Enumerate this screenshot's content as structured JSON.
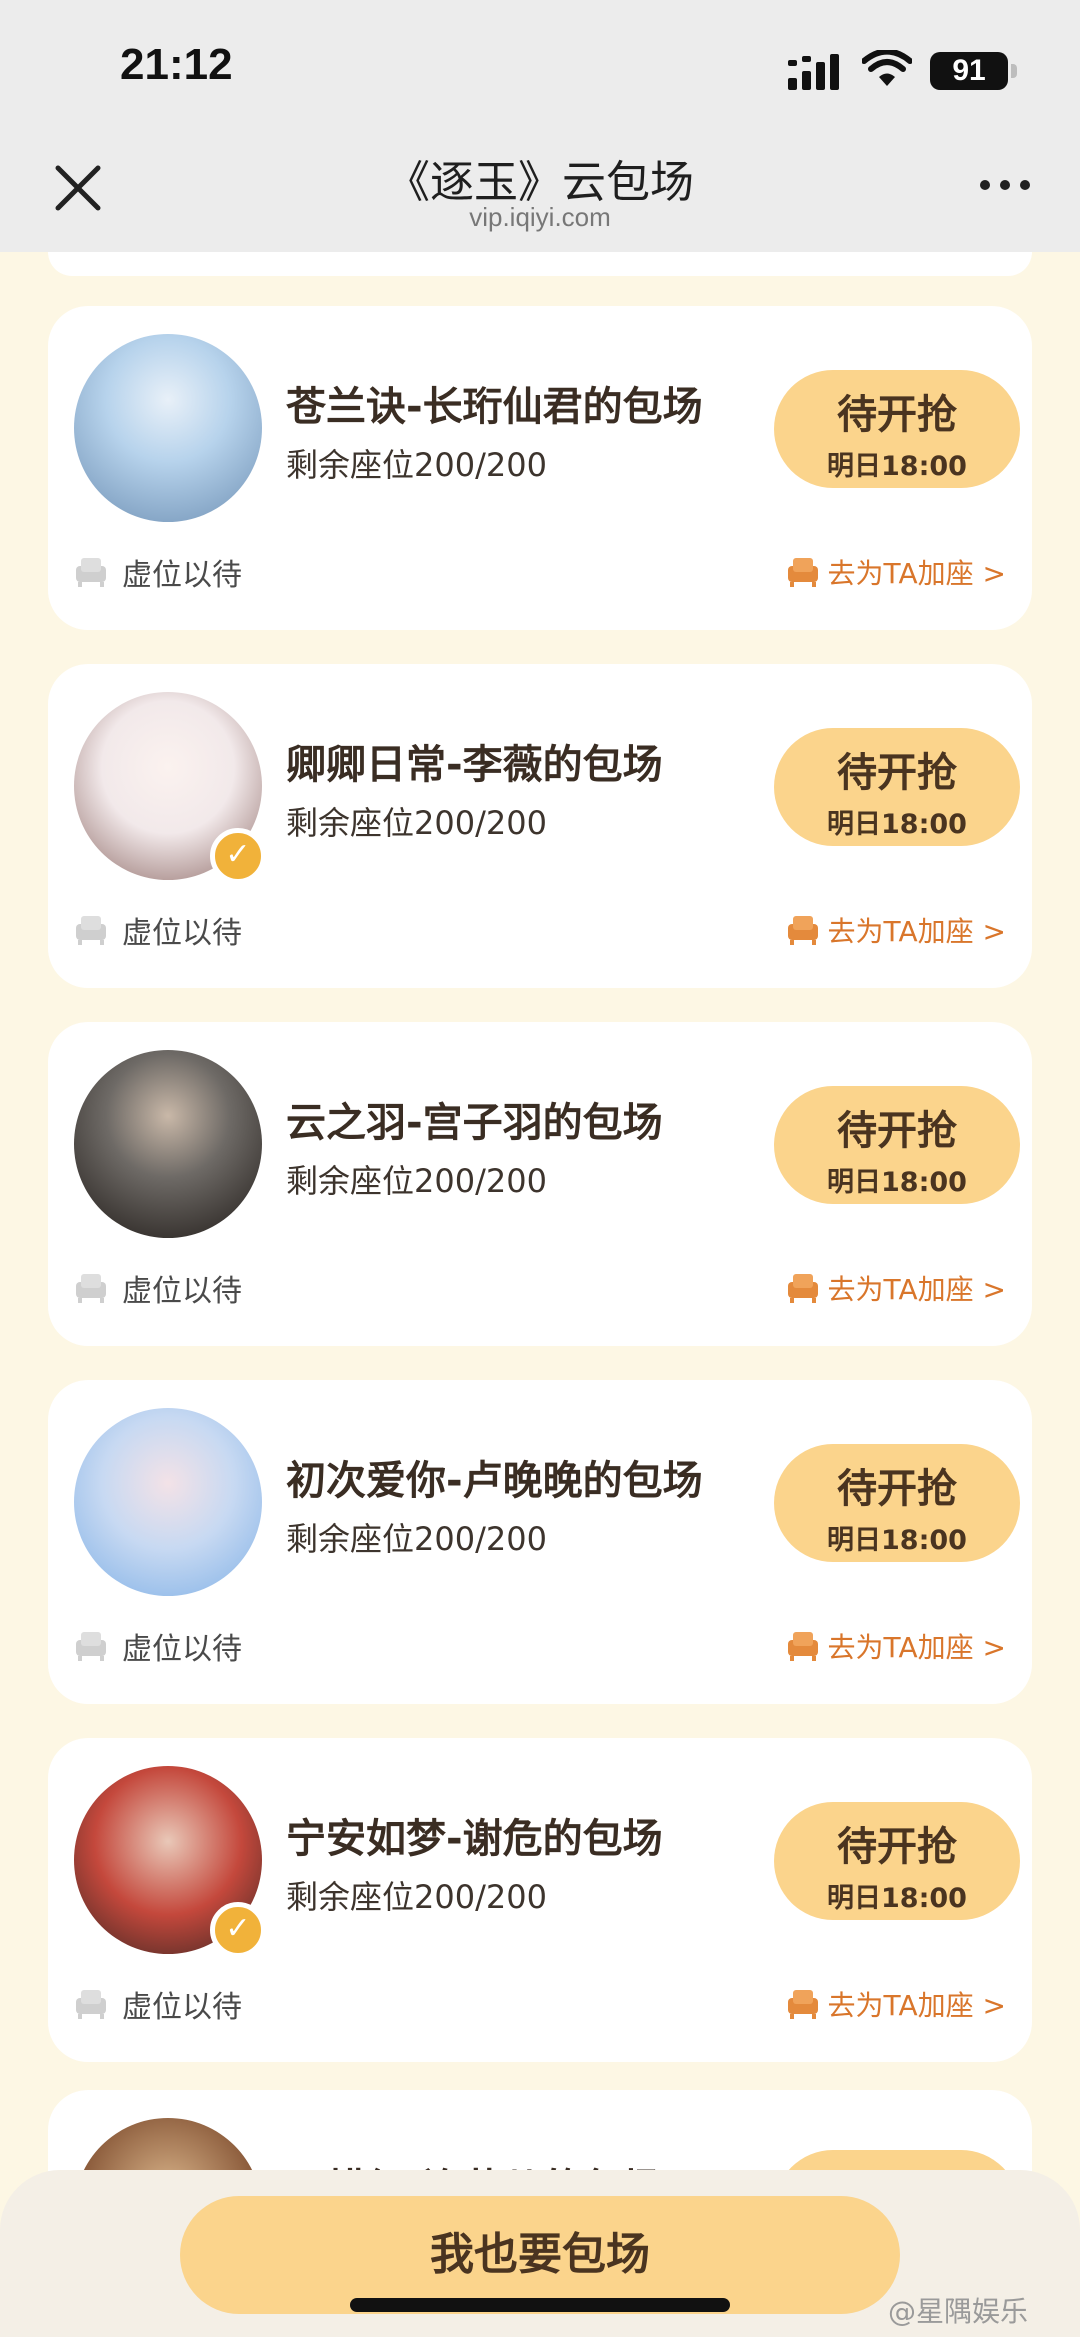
{
  "status": {
    "time": "21:12",
    "battery": "91"
  },
  "nav": {
    "title": "《逐玉》云包场",
    "subtitle": "vip.iqiyi.com"
  },
  "common": {
    "grab_label": "待开抢",
    "grab_time": "明日18:00",
    "wait_text": "虚位以待",
    "add_seat_text": "去为TA加座 >"
  },
  "cards": [
    {
      "title": "苍兰诀-长珩仙君的包场",
      "seats": "剩余座位200/200",
      "verified": false,
      "avatar_colors": [
        "#b7d3ec",
        "#6d8fb3"
      ]
    },
    {
      "title": "卿卿日常-李薇的包场",
      "seats": "剩余座位200/200",
      "verified": true,
      "avatar_colors": [
        "#f2e9ea",
        "#8e6b67"
      ]
    },
    {
      "title": "云之羽-宫子羽的包场",
      "seats": "剩余座位200/200",
      "verified": false,
      "avatar_colors": [
        "#6e6a66",
        "#1f1a17"
      ]
    },
    {
      "title": "初次爱你-卢晚晚的包场",
      "seats": "剩余座位200/200",
      "verified": false,
      "avatar_colors": [
        "#7fb0e6",
        "#f3e2e7"
      ]
    },
    {
      "title": "宁安如梦-谢危的包场",
      "seats": "剩余座位200/200",
      "verified": true,
      "avatar_colors": [
        "#c4483c",
        "#3a2622"
      ]
    }
  ],
  "partial_card": {
    "title": "田耕纪-连蔓儿的包场"
  },
  "cta": {
    "label": "我也要包场"
  },
  "watermark": "@星隅娱乐",
  "colors": {
    "accent": "#fbd48c",
    "link": "#d9762b",
    "background": "#fdf7e4"
  }
}
